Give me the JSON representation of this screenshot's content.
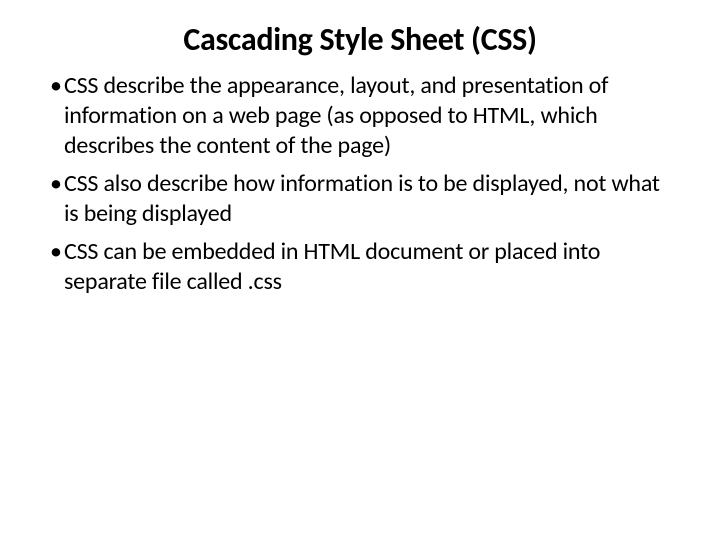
{
  "slide": {
    "title": "Cascading Style Sheet (CSS)",
    "bullets": [
      "CSS describe the appearance, layout, and presentation of information on a web page (as opposed to HTML, which describes the content of the page)",
      "CSS also describe how information is to be displayed, not what is being displayed",
      "CSS can be embedded in HTML document or placed into separate file called .css"
    ]
  }
}
